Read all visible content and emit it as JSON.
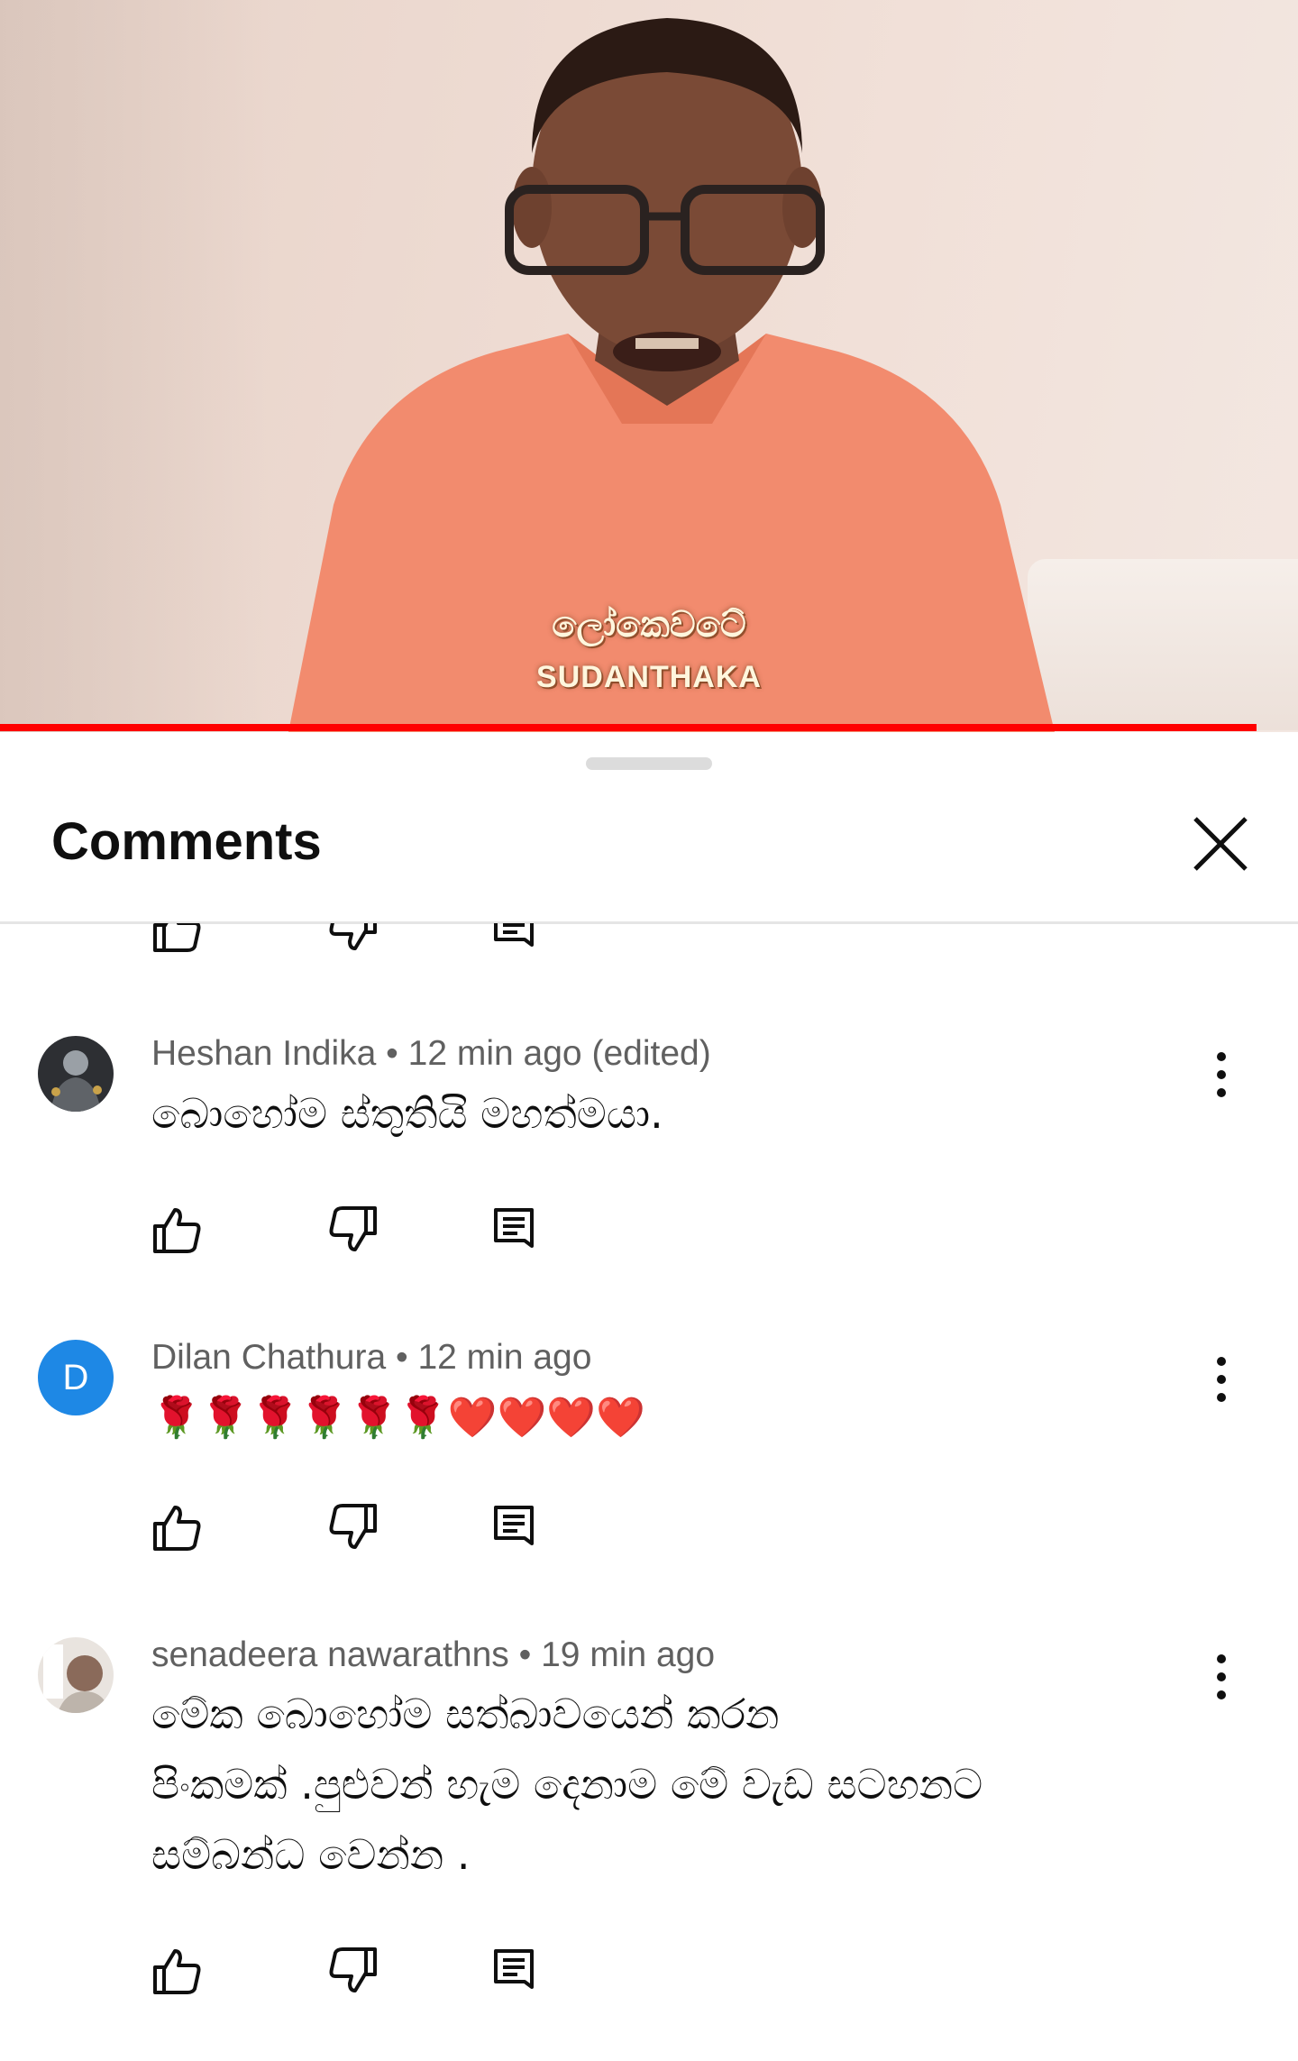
{
  "video": {
    "subtitle_line1": "ලෝකෙවටේ",
    "subtitle_line2": "SUDANTHAKA",
    "progress_fraction": 0.968,
    "progress_color": "#ff0000"
  },
  "panel": {
    "title": "Comments",
    "close_icon": "close-icon"
  },
  "comments": [
    {
      "author": "Heshan Indika",
      "meta": "Heshan Indika • 12 min ago (edited)",
      "text": "බොහෝම ස්තුතියි මහත්මයා.",
      "avatar": "photo"
    },
    {
      "author": "Dilan Chathura",
      "meta": "Dilan Chathura • 12 min ago",
      "text": "🌹🌹🌹🌹🌹🌹❤️❤️❤️❤️",
      "avatar_letter": "D",
      "avatar_color": "#1e88e5"
    },
    {
      "author": "senadeera nawarathns",
      "meta": "senadeera nawarathns • 19 min ago",
      "text_lines": [
        "මේක බොහෝම සත්බාවයෙන් කරන",
        "පිංකමක් .පුළුවන් හැම දෙනාම මේ වැඩ සටහනට",
        "සම්බන්ධ වෙන්න ."
      ],
      "avatar": "photo"
    }
  ]
}
